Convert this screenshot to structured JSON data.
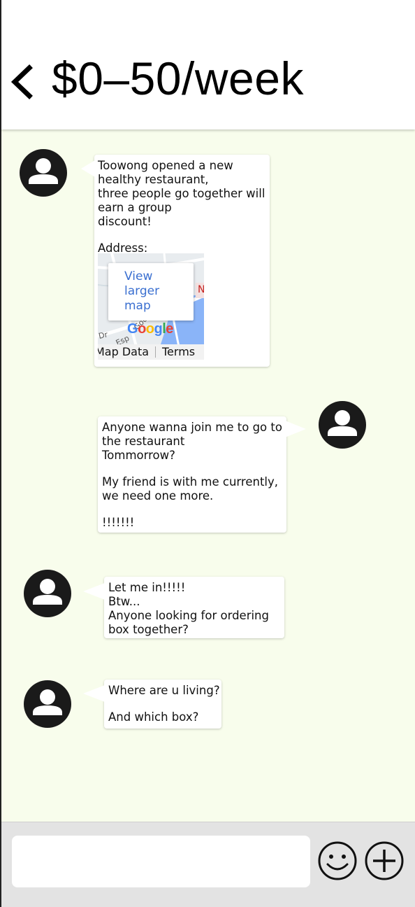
{
  "header": {
    "back_icon": "chevron-left-icon",
    "title": "$0–50/week"
  },
  "messages": [
    {
      "side": "left",
      "avatar_icon": "user-avatar-icon",
      "lines": [
        "Toowong opened a new",
        "healthy restaurant,",
        "three people go together will",
        "earn a group",
        "discount!",
        "",
        "Address:"
      ],
      "map": {
        "link_lines": [
          "View",
          "larger",
          "map"
        ],
        "footer_left": "Map Data",
        "footer_right": "Terms",
        "logo_text": "Google",
        "street_fragments": [
          "Dr",
          "Esp",
          "Goo"
        ]
      }
    },
    {
      "side": "right",
      "avatar_icon": "user-avatar-icon",
      "lines": [
        "Anyone wanna join me to go to",
        "the restaurant",
        "Tommorrow?",
        "",
        "My friend is with me currently,",
        "we need one more.",
        "",
        "!!!!!!!"
      ]
    },
    {
      "side": "left",
      "avatar_icon": "user-avatar-icon",
      "lines": [
        "Let me in!!!!!",
        "Btw...",
        "Anyone looking for ordering",
        "box together?"
      ]
    },
    {
      "side": "left",
      "avatar_icon": "user-avatar-icon",
      "lines": [
        "Where are u living?",
        "",
        "And which box?"
      ]
    }
  ],
  "composer": {
    "placeholder": "",
    "emoji_icon": "smiley-icon",
    "add_icon": "plus-circle-icon"
  },
  "colors": {
    "chat_background": "#f8fdec",
    "bottom_bar": "#e3e3e3",
    "map_link": "#3a6fd0"
  }
}
